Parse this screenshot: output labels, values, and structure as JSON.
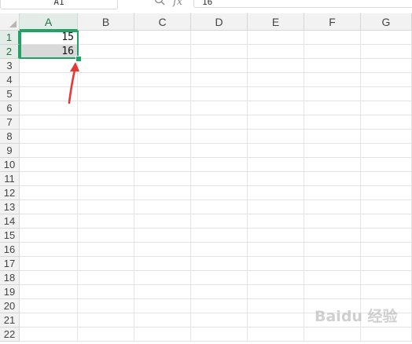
{
  "formula_bar": {
    "name_box": "A1",
    "fx_label": "fx",
    "formula_value": "16"
  },
  "columns": [
    "A",
    "B",
    "C",
    "D",
    "E",
    "F",
    "G"
  ],
  "rows": [
    "1",
    "2",
    "3",
    "4",
    "5",
    "6",
    "7",
    "8",
    "9",
    "10",
    "11",
    "12",
    "13",
    "14",
    "15",
    "16",
    "17",
    "18",
    "19",
    "20",
    "21",
    "22"
  ],
  "cells": {
    "A1": "15",
    "A2": "16"
  },
  "colors": {
    "accent": "#21a366",
    "arrow": "#e53935",
    "selected_fill": "#d9d9d9"
  },
  "watermark": "Baidu 经验"
}
